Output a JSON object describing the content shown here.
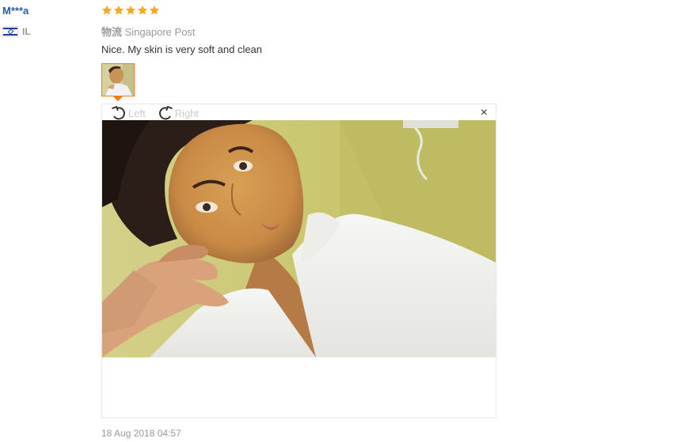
{
  "reviewer": {
    "name": "M***a",
    "country": "IL",
    "flag_icon": "israel-flag-icon"
  },
  "review": {
    "rating": 5,
    "star_color": "#f5a623",
    "logistics_label": "物流",
    "logistics_value": "Singapore Post",
    "text": "Nice. My skin is very soft and clean",
    "date": "18 Aug 2018 04:57"
  },
  "viewer": {
    "rotate_left_label": "Left",
    "rotate_right_label": "Right",
    "close_glyph": "×",
    "image_subject": "selfie-photo"
  },
  "colors": {
    "accent": "#e67e22",
    "name_blue": "#2a5aa8",
    "muted": "#999999"
  }
}
